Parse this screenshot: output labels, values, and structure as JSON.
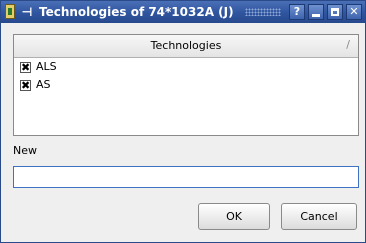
{
  "window": {
    "title": "Technologies of 74*1032A (J)",
    "buttons": {
      "help": "?",
      "close": "✕"
    }
  },
  "technologies_list": {
    "header": "Technologies",
    "sort_indicator": "/",
    "items": [
      {
        "label": "ALS",
        "checked": true,
        "mark": "✖"
      },
      {
        "label": "AS",
        "checked": true,
        "mark": "✖"
      }
    ]
  },
  "new_field": {
    "label": "New",
    "value": ""
  },
  "actions": {
    "ok": "OK",
    "cancel": "Cancel"
  }
}
